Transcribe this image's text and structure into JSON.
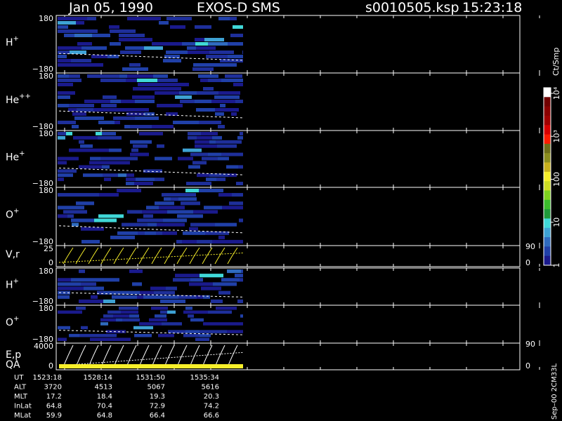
{
  "header": {
    "date": "Jan 05, 1990",
    "mission": "EXOS-D SMS",
    "file": "s0010505.ksp",
    "time": "15:23:18"
  },
  "colorbar": {
    "unit": "Ct/Smp",
    "tick_labels": [
      "1",
      "10",
      "100",
      "10³",
      "10⁴"
    ],
    "tick_values": [
      1,
      10,
      100,
      1000,
      10000
    ],
    "colors": [
      "#1a1a8c",
      "#2040a8",
      "#2f6bbf",
      "#3ea2d4",
      "#40d8d8",
      "#1f9a3a",
      "#3bbd2c",
      "#7ed31e",
      "#cddc22",
      "#f7ef2a",
      "#c7b01d",
      "#8b8d1e",
      "#6e6e18",
      "#ff1b00",
      "#d80000",
      "#a00000",
      "#8a0000",
      "#700000",
      "#ffffff"
    ]
  },
  "chart_data": [
    {
      "type": "heatmap",
      "name": "H+",
      "label_base": "H",
      "label_sup": "+",
      "ymax_label": "180",
      "ymin_label": "−180",
      "ylim": [
        -180,
        180
      ]
    },
    {
      "type": "heatmap",
      "name": "He++",
      "label_base": "He",
      "label_sup": "++",
      "ymax_label": "180",
      "ymin_label": "−180",
      "ylim": [
        -180,
        180
      ]
    },
    {
      "type": "heatmap",
      "name": "He+",
      "label_base": "He",
      "label_sup": "+",
      "ymax_label": "180",
      "ymin_label": "−180",
      "ylim": [
        -180,
        180
      ]
    },
    {
      "type": "heatmap",
      "name": "O+",
      "label_base": "O",
      "label_sup": "+",
      "ymax_label": "180",
      "ymin_label": "−180",
      "ylim": [
        -180,
        180
      ]
    },
    {
      "type": "line",
      "name": "V,r",
      "label_base": "V,r",
      "label_sup": "",
      "ymax_label": "25",
      "ymin_label": "0",
      "ylim": [
        0,
        25
      ],
      "right_top": "90",
      "right_bottom": "0"
    },
    {
      "type": "heatmap",
      "name": "H+ (2)",
      "label_base": "H",
      "label_sup": "+",
      "ymax_label": "180",
      "ymin_label": "−180",
      "ylim": [
        -180,
        180
      ]
    },
    {
      "type": "heatmap",
      "name": "O+ (2)",
      "label_base": "O",
      "label_sup": "+",
      "ymax_label": "180",
      "ymin_label": "−180",
      "ylim": [
        -180,
        180
      ]
    },
    {
      "type": "line",
      "name": "E,p",
      "label_base": "E,p",
      "label_sup": "",
      "ymax_label": "4000",
      "ymin_label": "0",
      "ylim": [
        0,
        4000
      ],
      "right_top": "90",
      "right_bottom": "0"
    }
  ],
  "qa_label": "QA",
  "ephemeris": {
    "rows": [
      {
        "label": "UT",
        "values": [
          "1523:18",
          "1528:14",
          "1531:50",
          "1535:34"
        ]
      },
      {
        "label": "ALT",
        "values": [
          "3720",
          "4513",
          "5067",
          "5616"
        ]
      },
      {
        "label": "MLT",
        "values": [
          "17.2",
          "18.4",
          "19.3",
          "20.3"
        ]
      },
      {
        "label": "InLat",
        "values": [
          "64.8",
          "70.4",
          "72.9",
          "74.2"
        ]
      },
      {
        "label": "MLat",
        "values": [
          "59.9",
          "64.8",
          "66.4",
          "66.6"
        ]
      }
    ]
  },
  "footer_note": "Sep–00 2CM33L"
}
